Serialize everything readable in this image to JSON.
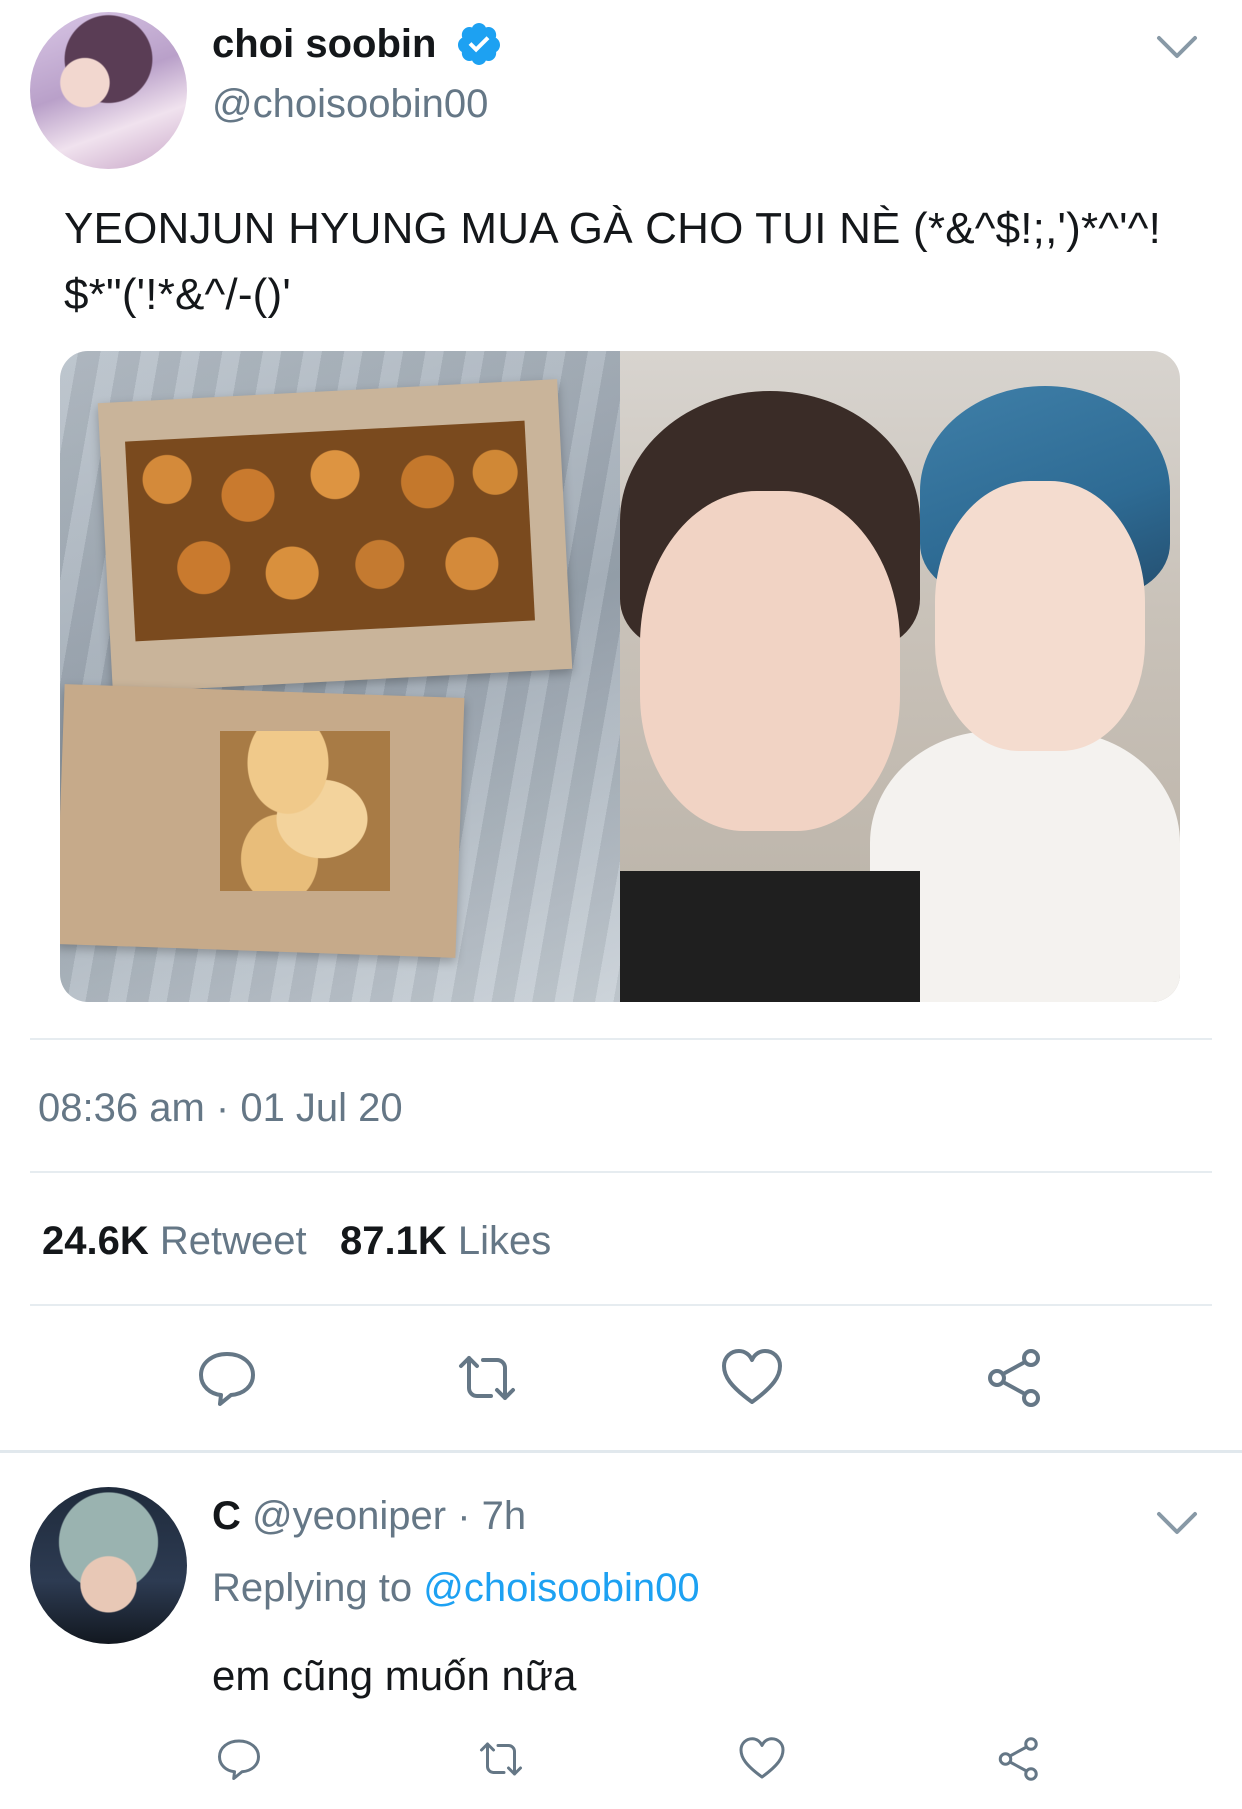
{
  "tweet": {
    "author_name": "choi soobin",
    "author_handle": "@choisoobin00",
    "text_line1": "YEONJUN HYUNG MUA GÀ CHO TUI NÈ (*&^$!;,')*^'^!",
    "text_line2": "$*\"('!*&^/-()'",
    "timestamp": "08:36 am · 01 Jul 20",
    "retweet_count": "24.6K",
    "retweet_label": "Retweet",
    "like_count": "87.1K",
    "like_label": "Likes"
  },
  "reply": {
    "author_name": "C",
    "author_handle": "@yeoniper",
    "time": "· 7h",
    "replying_prefix": "Replying to",
    "replying_to": "@choisoobin00",
    "text": "em cũng muốn nữa"
  },
  "icons": {
    "verified": "verified-badge-icon",
    "chevron": "chevron-down-icon",
    "reply": "comment-icon",
    "retweet": "retweet-icon",
    "like": "heart-icon",
    "share": "share-icon"
  },
  "colors": {
    "accent": "#1da1f2",
    "secondary_text": "#657786",
    "action_icon": "#657786"
  }
}
